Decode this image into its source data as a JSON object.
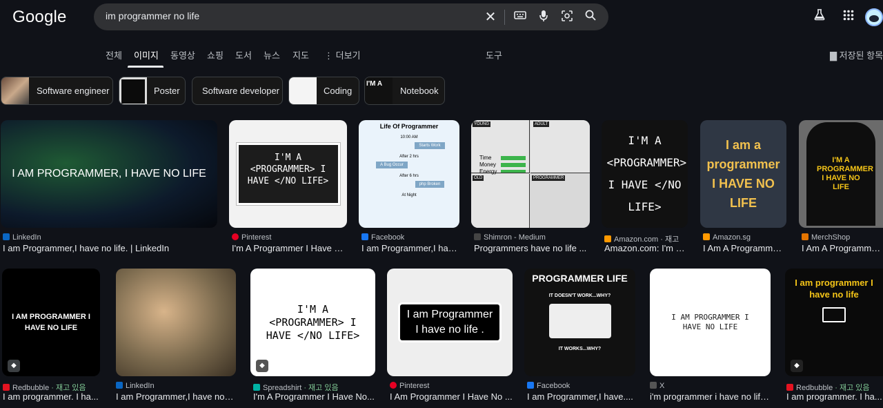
{
  "header": {
    "logo": "Google",
    "query": "im programmer no life",
    "icons": [
      "close-icon",
      "keyboard-icon",
      "mic-icon",
      "lens-icon",
      "search-icon",
      "labs-icon",
      "apps-icon"
    ]
  },
  "tabs": [
    "전체",
    "이미지",
    "동영상",
    "쇼핑",
    "도서",
    "뉴스",
    "지도",
    "⋮ 더보기",
    "도구"
  ],
  "active_tab": "이미지",
  "saved_label": "저장된 항목",
  "chips": [
    "Software engineer",
    "Poster",
    "Software developer",
    "Coding",
    "Notebook"
  ],
  "row1": [
    {
      "source": "LinkedIn",
      "title": "I am Programmer,I have no life. | LinkedIn",
      "art": "I AM PROGRAMMER, I HAVE NO LIFE",
      "fav": "#0a66c2"
    },
    {
      "source": "Pinterest",
      "title": "I'm A Programmer I Have No Life...",
      "art": "I'M A <PROGRAMMER> I HAVE </NO LIFE>",
      "fav": "#e60023"
    },
    {
      "source": "Facebook",
      "title": "I am Programmer,I have no life...",
      "art": "Life Of Programmer",
      "fav": "#1877f2"
    },
    {
      "source": "Shimron - Medium",
      "title": "Programmers have no life ...",
      "art": "YOUNG  ADULT  OLD  PROGRAMMER",
      "fav": "#444"
    },
    {
      "source": "Amazon.com",
      "stock": "재고",
      "title": "Amazon.com: I'm a...",
      "art": "I'M A <PROGRAMMER> I HAVE </NO LIFE>",
      "fav": "#ff9900"
    },
    {
      "source": "Amazon.sg",
      "title": "I Am A Programmer...",
      "art": "I am a programmer I HAVE NO LIFE",
      "fav": "#ff9900"
    },
    {
      "source": "MerchShop",
      "title": "I Am A Programmer...",
      "art": "I'M A PROGRAMMER I HAVE NO LIFE",
      "fav": "#e37400"
    }
  ],
  "row2": [
    {
      "source": "Redbubble",
      "stock": "· 재고 있음",
      "title": "I am programmer. I ha...",
      "art": "I AM PROGRAMMER I HAVE NO LIFE",
      "fav": "#e41321"
    },
    {
      "source": "LinkedIn",
      "title": "I am Programmer,I have no li...",
      "art": "",
      "fav": "#0a66c2"
    },
    {
      "source": "Spreadshirt",
      "stock": "· 재고 있음",
      "title": "I'm A Programmer I Have No...",
      "art": "I'M A <PROGRAMMER> I HAVE </NO LIFE>",
      "fav": "#00b2a5"
    },
    {
      "source": "Pinterest",
      "title": "I Am Programmer I Have No ...",
      "art": "I am Programmer I have no life .",
      "fav": "#e60023"
    },
    {
      "source": "Facebook",
      "title": "I am Programmer,I have....",
      "art": "PROGRAMMER LIFE",
      "fav": "#1877f2"
    },
    {
      "source": "X",
      "title": "i'm programmer i have no life...",
      "art": "I AM PROGRAMMER I HAVE NO LIFE",
      "fav": "#555"
    },
    {
      "source": "Redbubble",
      "stock": "· 재고 있음",
      "title": "I am programmer. I ha...",
      "art": "I am programmer I have no life",
      "fav": "#e41321"
    }
  ],
  "art_extra": {
    "r1c3": [
      "10:00 AM",
      "Starts Work",
      "After 2 hrs",
      "A Bug Occur",
      "After 6 hrs",
      "php Broken",
      "At Night"
    ],
    "r1c4": [
      "Time",
      "Money",
      "Energy"
    ],
    "r2c5": [
      "IT DOESN'T WORK...WHY?",
      "IT WORKS...WHY?"
    ]
  }
}
